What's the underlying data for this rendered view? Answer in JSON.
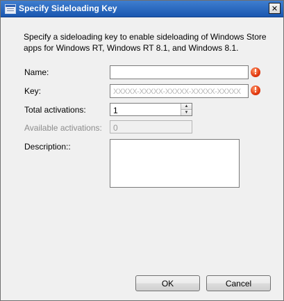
{
  "window": {
    "title": "Specify Sideloading Key",
    "close_glyph": "✕"
  },
  "description": "Specify a sideloading key to enable sideloading of Windows Store apps for Windows RT, Windows RT 8.1, and Windows 8.1.",
  "form": {
    "name_label": "Name:",
    "name_value": "",
    "key_label": "Key:",
    "key_value": "XXXXX-XXXXX-XXXXX-XXXXX-XXXXX",
    "total_label": "Total activations:",
    "total_value": "1",
    "available_label": "Available activations:",
    "available_value": "0",
    "description_label": "Description::",
    "description_value": ""
  },
  "icons": {
    "error": "error-icon",
    "spin_up": "▲",
    "spin_down": "▼",
    "error_glyph": "!"
  },
  "buttons": {
    "ok": "OK",
    "cancel": "Cancel"
  },
  "colors": {
    "title_bar": "#1a57b0",
    "error": "#e2380f"
  }
}
